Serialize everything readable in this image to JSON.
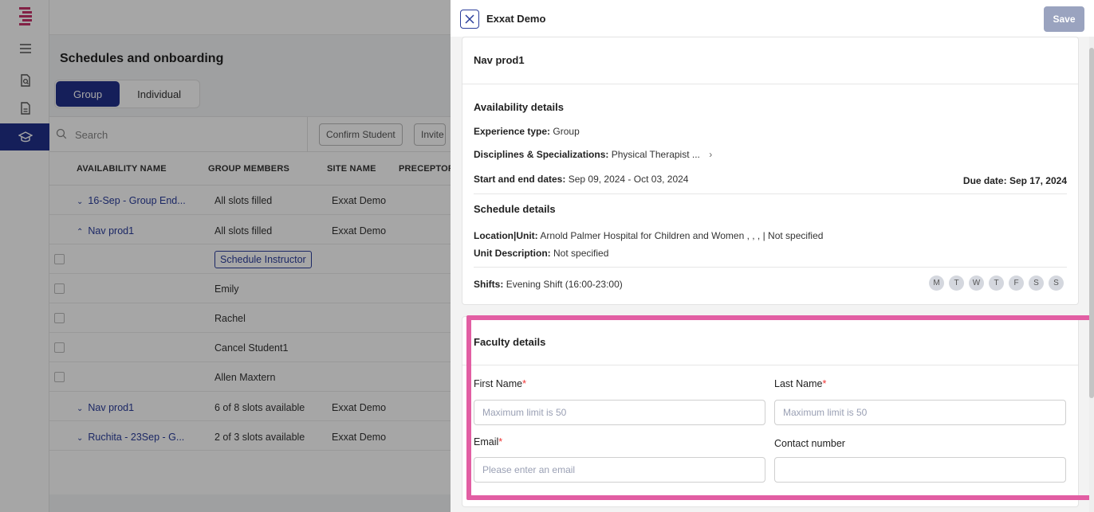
{
  "sidebar": {
    "logo": "exxat-logo",
    "items": [
      {
        "icon": "menu-icon"
      },
      {
        "icon": "document-search-icon"
      },
      {
        "icon": "document-list-icon"
      },
      {
        "icon": "graduation-cap-icon",
        "active": true
      }
    ]
  },
  "background": {
    "page_title": "Schedules and onboarding",
    "tabs": [
      {
        "label": "Group",
        "active": true
      },
      {
        "label": "Individual",
        "active": false
      }
    ],
    "search_placeholder": "Search",
    "buttons": {
      "confirm_student": "Confirm Student",
      "invite": "Invite"
    },
    "columns": [
      "AVAILABILITY NAME",
      "GROUP MEMBERS",
      "SITE NAME",
      "PRECEPTOR"
    ],
    "rows": [
      {
        "name": "16-Sep - Group End...",
        "members": "All slots filled",
        "site": "Exxat Demo",
        "expanded": false
      },
      {
        "name": "Nav prod1",
        "members": "All slots filled",
        "site": "Exxat Demo",
        "expanded": true
      },
      {
        "schedule_button": "Schedule Instructor"
      },
      {
        "member": "Emily"
      },
      {
        "member": "Rachel"
      },
      {
        "member": "Cancel Student1"
      },
      {
        "member": "Allen Maxtern"
      },
      {
        "name": "Nav prod1",
        "members": "6 of 8 slots available",
        "site": "Exxat Demo",
        "expanded": false
      },
      {
        "name": "Ruchita - 23Sep - G...",
        "members": "2 of 3 slots available",
        "site": "Exxat Demo",
        "expanded": false
      }
    ]
  },
  "drawer": {
    "title": "Exxat Demo",
    "save_label": "Save",
    "availability_card": {
      "name": "Nav prod1",
      "section_title": "Availability details",
      "experience_label": "Experience type:",
      "experience_value": "Group",
      "disciplines_label": "Disciplines & Specializations:",
      "disciplines_value": "Physical Therapist ...",
      "dates_label": "Start and end dates:",
      "dates_value": "Sep 09, 2024 - Oct 03, 2024",
      "due_label": "Due date:",
      "due_value": "Sep 17, 2024",
      "schedule_title": "Schedule details",
      "location_label": "Location|Unit:",
      "location_value": "Arnold Palmer Hospital for Children and Women , , , | Not specified",
      "unit_desc_label": "Unit Description:",
      "unit_desc_value": "Not specified",
      "shifts_label": "Shifts:",
      "shifts_value": "Evening Shift (16:00-23:00)",
      "days": [
        "M",
        "T",
        "W",
        "T",
        "F",
        "S",
        "S"
      ]
    },
    "faculty_card": {
      "title": "Faculty details",
      "first_name_label": "First Name",
      "first_name_placeholder": "Maximum limit is 50",
      "last_name_label": "Last Name",
      "last_name_placeholder": "Maximum limit is 50",
      "email_label": "Email",
      "email_placeholder": "Please enter an email",
      "contact_label": "Contact number",
      "contact_value": "",
      "required_mark": "*"
    },
    "highlight_color": "#e25ea3"
  }
}
